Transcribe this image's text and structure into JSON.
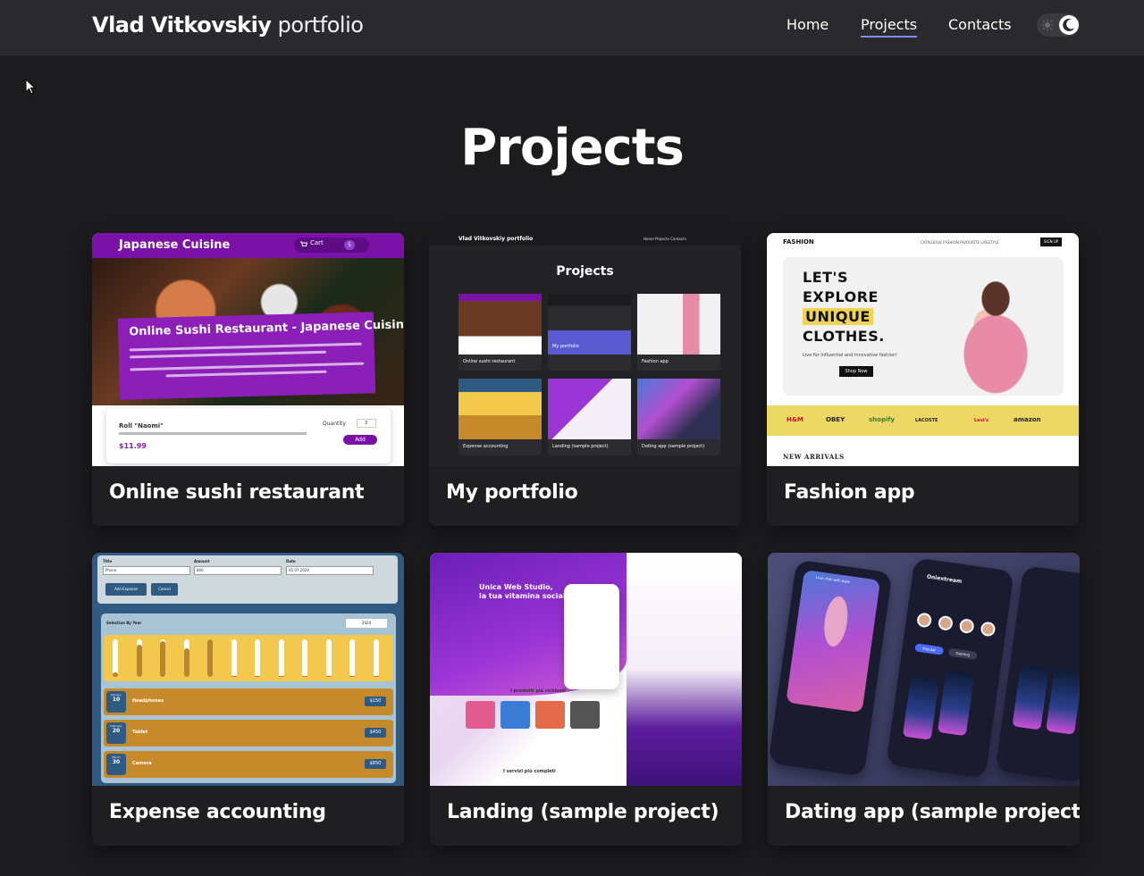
{
  "header": {
    "logo_bold": "Vlad Vitkovskiy",
    "logo_light": "portfolio",
    "nav": {
      "home": "Home",
      "projects": "Projects",
      "contacts": "Contacts"
    },
    "active": "Projects"
  },
  "page_title": "Projects",
  "projects": [
    {
      "title": "Online sushi restaurant",
      "thumb": {
        "bar_title": "Japanese Cuisine",
        "cart_label": "Cart",
        "cart_count": "5",
        "panel_title": "Online Sushi Restaurant - Japanese Cuisine",
        "item_name": "Roll \"Naomi\"",
        "item_price": "$11.99",
        "quantity_label": "Quantity",
        "quantity_value": "3",
        "add_label": "Add"
      }
    },
    {
      "title": "My portfolio",
      "thumb": {
        "logo": "Vlad Vitkovskiy portfolio",
        "links": "Home   Projects   Contacts",
        "heading": "Projects",
        "tiles": [
          "Online sushi restaurant",
          "My portfolio",
          "Fashion app",
          "Expense accounting",
          "Landing (sample project)",
          "Dating app (sample project)"
        ]
      }
    },
    {
      "title": "Fashion app",
      "thumb": {
        "logo": "FASHION",
        "links": "CATALOGUE    FASHION    FAVOURITE    LIFESTYLE",
        "signup": "SIGN UP",
        "heading_l1": "LET'S",
        "heading_l2": "EXPLORE",
        "heading_l3": "UNIQUE",
        "heading_l4": "CLOTHES.",
        "subtitle": "Live for Influential and Innovative fashion!",
        "shop_now": "Shop Now",
        "brands": [
          "H&M",
          "OBEY",
          "shopify",
          "LACOSTE",
          "Levi's",
          "amazon"
        ],
        "new_arrivals": "NEW ARRIVALS"
      }
    },
    {
      "title": "Expense accounting",
      "thumb": {
        "labels": {
          "title": "Title",
          "amount": "Amount",
          "date": "Date"
        },
        "values": {
          "title": "Phone",
          "amount": "800",
          "date": "05.07.2024"
        },
        "add_expense": "Add Expense",
        "cancel": "Cancel",
        "filter_label": "Selection By Year",
        "year": "2024",
        "bar_levels": [
          0.12,
          0.85,
          0.95,
          0.75,
          1.0,
          0.02,
          0.02,
          0.02,
          0.02,
          0.02,
          0.02,
          0.02
        ],
        "expenses": [
          {
            "month": "January",
            "day": "10",
            "name": "Headphones",
            "amount": "$150"
          },
          {
            "month": "February",
            "day": "20",
            "name": "Tablet",
            "amount": "$450"
          },
          {
            "month": "March",
            "day": "30",
            "name": "Camera",
            "amount": "$850"
          }
        ]
      }
    },
    {
      "title": "Landing (sample project)",
      "thumb": {
        "hero_l1": "Unica Web Studio,",
        "hero_l2": "la tua vitamina social!",
        "products": "I prodotti più richiesti",
        "services": "I servizi più completi"
      }
    },
    {
      "title": "Dating app (sample project)",
      "thumb": {
        "chat_label": "Live chat with Kate",
        "app_name": "Oniextream",
        "popular": "Popular",
        "gaming": "Gaming"
      }
    }
  ],
  "colors": {
    "background": "#1c1c1f",
    "navbar": "#2a2a2e",
    "accent_underline": "#7a8cff",
    "card": "#1f1f22"
  },
  "icons": {
    "theme_light": "sun-icon",
    "theme_dark": "moon-icon",
    "pointer": "cursor-icon"
  }
}
